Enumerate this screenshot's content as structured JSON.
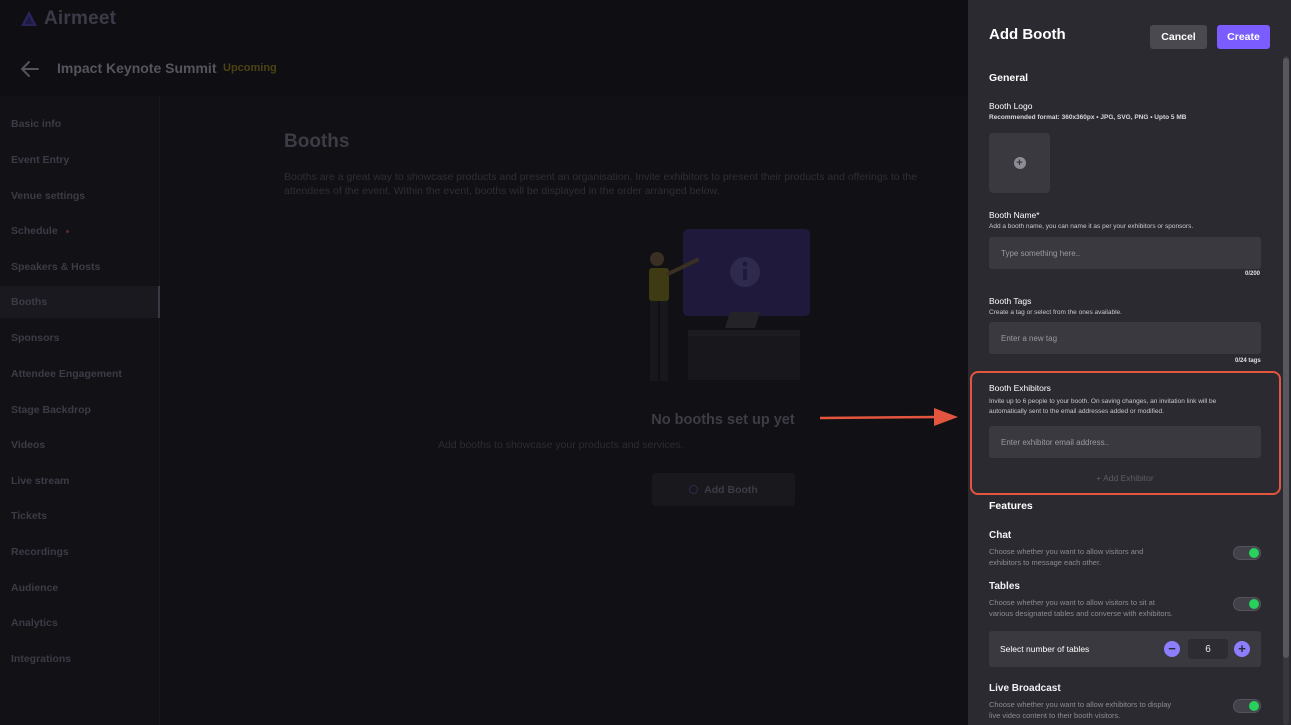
{
  "app": {
    "logo_text": "Airmeet"
  },
  "header": {
    "event_title": "Impact Keynote Summit",
    "event_status": "Upcoming"
  },
  "sidebar": {
    "items": [
      {
        "label": "Basic info"
      },
      {
        "label": "Event Entry"
      },
      {
        "label": "Venue settings"
      },
      {
        "label": "Schedule"
      },
      {
        "label": "Speakers & Hosts"
      },
      {
        "label": "Booths"
      },
      {
        "label": "Sponsors"
      },
      {
        "label": "Attendee Engagement"
      },
      {
        "label": "Stage Backdrop"
      },
      {
        "label": "Videos"
      },
      {
        "label": "Live stream"
      },
      {
        "label": "Tickets"
      },
      {
        "label": "Recordings"
      },
      {
        "label": "Audience"
      },
      {
        "label": "Analytics"
      },
      {
        "label": "Integrations"
      }
    ],
    "active": "Booths"
  },
  "main": {
    "title": "Booths",
    "description": "Booths are a great way to showcase products and present an organisation. Invite exhibitors to present their products and offerings to the attendees of the event. Within the event, booths will be displayed in the order arranged below.",
    "empty_title": "No booths set up yet",
    "empty_subtitle": "Add booths to showcase your products and services.",
    "add_booth_label": "Add Booth"
  },
  "panel": {
    "title": "Add Booth",
    "cancel_label": "Cancel",
    "create_label": "Create",
    "general_title": "General",
    "logo": {
      "label": "Booth Logo",
      "hint": "Recommended format: 360x360px • JPG, SVG, PNG • Upto 5 MB"
    },
    "name": {
      "label": "Booth Name*",
      "hint": "Add a booth name, you can name it as per your exhibitors or sponsors.",
      "placeholder": "Type something here..",
      "counter": "0/200"
    },
    "tags": {
      "label": "Booth Tags",
      "hint": "Create a tag or select from the ones available.",
      "placeholder": "Enter a new tag",
      "counter": "0/24 tags"
    },
    "exhibitors": {
      "label": "Booth Exhibitors",
      "hint_line1": "Invite up to 6 people to your booth. On saving changes, an invitation link will be",
      "hint_line2": "automatically sent to the email addresses added or modified.",
      "placeholder": "Enter exhibitor email address..",
      "add_label": "+ Add Exhibitor"
    },
    "features_title": "Features",
    "features": {
      "chat": {
        "title": "Chat",
        "desc_line1": "Choose whether you want to allow visitors and",
        "desc_line2": "exhibitors to message each other.",
        "enabled": true
      },
      "tables": {
        "title": "Tables",
        "desc_line1": "Choose whether you want to allow visitors to sit at",
        "desc_line2": "various designated tables and converse with exhibitors.",
        "enabled": true,
        "count_label": "Select number of tables",
        "count": "6"
      },
      "live_broadcast": {
        "title": "Live Broadcast",
        "desc_line1": "Choose whether you want to allow exhibitors to display",
        "desc_line2": "live video content to their booth visitors.",
        "enabled": true
      }
    }
  },
  "colors": {
    "accent": "#7b5cff",
    "toggle_on": "#28d05c",
    "highlight": "#e4553f",
    "status_upcoming": "#4d4312"
  }
}
